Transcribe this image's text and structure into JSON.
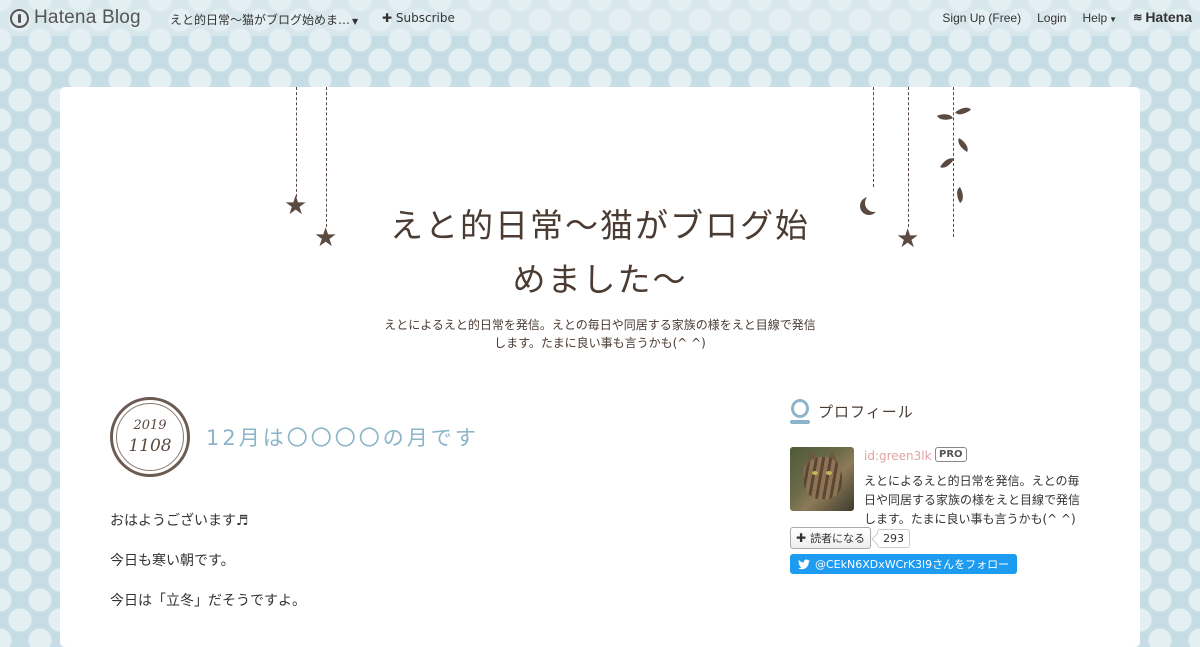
{
  "topbar": {
    "logo_text": "Hatena Blog",
    "blog_name": "えと的日常〜猫がブログ始めま…",
    "subscribe_label": "Subscribe",
    "signup_label": "Sign Up (Free)",
    "login_label": "Login",
    "help_label": "Help",
    "brand_label": "Hatena"
  },
  "header": {
    "title_line1": "えと的日常〜猫がブログ始",
    "title_line2": "めました〜",
    "description_line1": "えとによるえと的日常を発信。えとの毎日や同居する家族の様をえと目線で発信",
    "description_line2": "します。たまに良い事も言うかも(^ ^)"
  },
  "entry": {
    "date_year": "2019",
    "date_monthday": "1108",
    "title": "12月は〇〇〇〇の月です",
    "paragraphs": [
      "おはようございます♬",
      "今日も寒い朝です。",
      "今日は「立冬」だそうですよ。"
    ]
  },
  "sidebar": {
    "profile_heading": "プロフィール",
    "user_id": "id:green3lk",
    "pro_badge": "PRO",
    "description": "えとによるえと的日常を発信。えとの毎日や同居する家族の様をえと目線で発信します。たまに良い事も言うかも(^ ^)",
    "reader_button": "読者になる",
    "reader_count": "293",
    "twitter_follow": "@CEkN6XDxWCrK3l9さんをフォロー"
  },
  "icons": [
    "hatena-blog-logo-icon",
    "caret-down-icon",
    "plus-icon",
    "hatena-brand-icon",
    "star-icon",
    "moon-icon",
    "leaf-icon",
    "profile-icon",
    "twitter-bird-icon"
  ],
  "colors": {
    "background": "#c7dde5",
    "polka_dot": "#e4eff3",
    "title_brown": "#4a3b33",
    "entry_title_blue": "#8cb5c9",
    "user_id_pink": "#e0a3a3",
    "twitter_blue": "#1d9bf0"
  }
}
